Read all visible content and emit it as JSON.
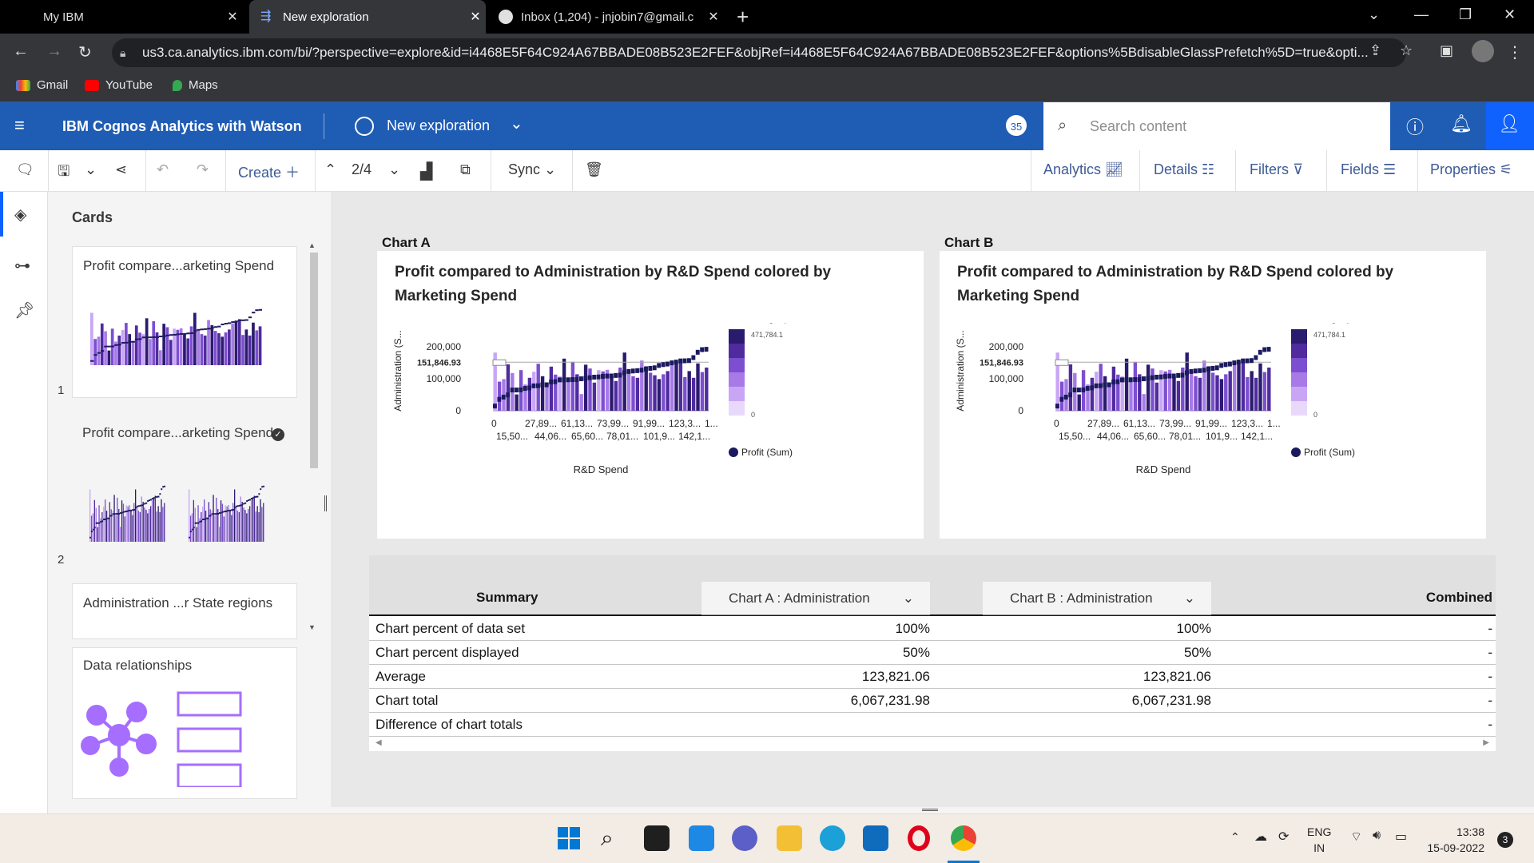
{
  "browser": {
    "tabs": [
      {
        "label": "My IBM"
      },
      {
        "label": "New exploration"
      },
      {
        "label": "Inbox (1,204) - jnjobin7@gmail.c"
      }
    ],
    "url": "us3.ca.analytics.ibm.com/bi/?perspective=explore&id=i4468E5F64C924A67BBADE08B523E2FEF&objRef=i4468E5F64C924A67BBADE08B523E2FEF&options%5BdisableGlassPrefetch%5D=true&opti...",
    "bookmarks": [
      {
        "label": "Gmail"
      },
      {
        "label": "YouTube"
      },
      {
        "label": "Maps"
      }
    ]
  },
  "header": {
    "brand": "IBM Cognos Analytics with Watson",
    "exploration": "New exploration",
    "badge": "35",
    "search_placeholder": "Search content"
  },
  "toolbar": {
    "create": "Create",
    "page": "2/4",
    "sync": "Sync",
    "analytics": "Analytics",
    "details": "Details",
    "filters": "Filters",
    "fields": "Fields",
    "properties": "Properties"
  },
  "cards_panel": {
    "title": "Cards",
    "cards": [
      {
        "title": "Profit compare...arketing Spend",
        "number": "1"
      },
      {
        "title": "Profit compare...arketing Spend",
        "number": "2"
      },
      {
        "title": "Administration ...r State regions"
      },
      {
        "title": "Data relationships"
      }
    ]
  },
  "charts": [
    {
      "label": "Chart A",
      "title": "Profit compared to Administration by R&D Spend colored by Marketing Spend"
    },
    {
      "label": "Chart B",
      "title": "Profit compared to Administration by R&D Spend colored by Marketing Spend"
    }
  ],
  "chart_data": [
    {
      "type": "bar",
      "title": "Profit compared to Administration by R&D Spend colored by Marketing Spend",
      "xlabel": "R&D Spend",
      "ylabel": "Administration (S...",
      "x_ticks_top": [
        "0",
        "27,89...",
        "61,13...",
        "73,99...",
        "91,99...",
        "123,3...",
        "1..."
      ],
      "x_ticks_bottom": [
        "15,50...",
        "44,06...",
        "65,60...",
        "78,01...",
        "101,9...",
        "142,1..."
      ],
      "y_ticks": [
        "200,000",
        "100,000",
        "0"
      ],
      "reference_line": "151,846.93",
      "ylim": [
        0,
        250000
      ],
      "legend_title": "Marketing Spend ...",
      "legend_max": "471,784.1",
      "legend_min": "0",
      "series_legend": "Profit (Sum)",
      "bar_values": [
        182000,
        91000,
        99000,
        145000,
        118000,
        51000,
        127000,
        82000,
        103000,
        122000,
        147000,
        108000,
        85000,
        138000,
        113000,
        108000,
        163000,
        91000,
        153000,
        114000,
        52000,
        144000,
        132000,
        88000,
        127000,
        123000,
        128000,
        108000,
        93000,
        135000,
        182000,
        125000,
        108000,
        103000,
        157000,
        139000,
        119000,
        111000,
        99000,
        114000,
        124000,
        145000,
        154000,
        160000,
        105000,
        124000,
        103000,
        148000,
        121000,
        135000
      ],
      "profit_values": [
        14600,
        35700,
        42600,
        49500,
        64900,
        64900,
        65200,
        69800,
        71500,
        77800,
        78200,
        81000,
        81200,
        89900,
        90700,
        96500,
        96700,
        96800,
        97400,
        97400,
        99900,
        101000,
        103300,
        105000,
        105700,
        107400,
        108600,
        108700,
        110400,
        111300,
        118500,
        122800,
        124300,
        125400,
        126900,
        129900,
        132600,
        134300,
        141600,
        144300,
        146100,
        149800,
        152200,
        155800,
        156100,
        156900,
        166200,
        182900,
        191100,
        192300
      ],
      "color_levels": [
        1,
        3,
        2,
        4,
        2,
        5,
        3,
        2,
        4,
        1,
        3,
        5,
        2,
        4,
        3,
        1,
        5,
        2,
        3,
        4,
        2,
        5,
        3,
        4,
        1,
        3,
        2,
        5,
        4,
        3,
        5,
        2,
        3,
        4,
        2,
        5,
        3,
        4,
        5,
        3,
        4,
        2,
        5,
        4,
        3,
        5,
        4,
        5,
        3,
        4
      ]
    },
    {
      "type": "bar",
      "title": "Profit compared to Administration by R&D Spend colored by Marketing Spend",
      "xlabel": "R&D Spend",
      "ylabel": "Administration (S...",
      "x_ticks_top": [
        "0",
        "27,89...",
        "61,13...",
        "73,99...",
        "91,99...",
        "123,3...",
        "1..."
      ],
      "x_ticks_bottom": [
        "15,50...",
        "44,06...",
        "65,60...",
        "78,01...",
        "101,9...",
        "142,1..."
      ],
      "y_ticks": [
        "200,000",
        "100,000",
        "0"
      ],
      "reference_line": "151,846.93",
      "ylim": [
        0,
        250000
      ],
      "legend_title": "Marketing Spend ...",
      "legend_max": "471,784.1",
      "legend_min": "0",
      "series_legend": "Profit (Sum)",
      "bar_values": [
        182000,
        91000,
        99000,
        145000,
        118000,
        51000,
        127000,
        82000,
        103000,
        122000,
        147000,
        108000,
        85000,
        138000,
        113000,
        108000,
        163000,
        91000,
        153000,
        114000,
        52000,
        144000,
        132000,
        88000,
        127000,
        123000,
        128000,
        108000,
        93000,
        135000,
        182000,
        125000,
        108000,
        103000,
        157000,
        139000,
        119000,
        111000,
        99000,
        114000,
        124000,
        145000,
        154000,
        160000,
        105000,
        124000,
        103000,
        148000,
        121000,
        135000
      ],
      "profit_values": [
        14600,
        35700,
        42600,
        49500,
        64900,
        64900,
        65200,
        69800,
        71500,
        77800,
        78200,
        81000,
        81200,
        89900,
        90700,
        96500,
        96700,
        96800,
        97400,
        97400,
        99900,
        101000,
        103300,
        105000,
        105700,
        107400,
        108600,
        108700,
        110400,
        111300,
        118500,
        122800,
        124300,
        125400,
        126900,
        129900,
        132600,
        134300,
        141600,
        144300,
        146100,
        149800,
        152200,
        155800,
        156100,
        156900,
        166200,
        182900,
        191100,
        192300
      ],
      "color_levels": [
        1,
        3,
        2,
        4,
        2,
        5,
        3,
        2,
        4,
        1,
        3,
        5,
        2,
        4,
        3,
        1,
        5,
        2,
        3,
        4,
        2,
        5,
        3,
        4,
        1,
        3,
        2,
        5,
        4,
        3,
        5,
        2,
        3,
        4,
        2,
        5,
        3,
        4,
        5,
        3,
        4,
        2,
        5,
        4,
        3,
        5,
        4,
        5,
        3,
        4
      ]
    }
  ],
  "summary": {
    "title": "Summary",
    "col_a": "Chart A : Administration",
    "col_b": "Chart B : Administration",
    "col_combined": "Combined",
    "rows": [
      {
        "label": "Chart percent of data set",
        "a": "100%",
        "b": "100%",
        "c": "-"
      },
      {
        "label": "Chart percent displayed",
        "a": "50%",
        "b": "50%",
        "c": "-"
      },
      {
        "label": "Average",
        "a": "123,821.06",
        "b": "123,821.06",
        "c": "-"
      },
      {
        "label": "Chart total",
        "a": "6,067,231.98",
        "b": "6,067,231.98",
        "c": "-"
      },
      {
        "label": "Difference of chart totals",
        "a": "",
        "b": "",
        "c": "-"
      }
    ]
  },
  "taskbar": {
    "lang": "ENG",
    "region": "IN",
    "time": "13:38",
    "date": "15-09-2022",
    "notif": "3"
  },
  "colors": {
    "ibm_blue": "#1f5cb4",
    "bar_dark": "#2b1b6e",
    "bar_light": "#e9d8fb",
    "profit_line": "#1c1a5e"
  }
}
